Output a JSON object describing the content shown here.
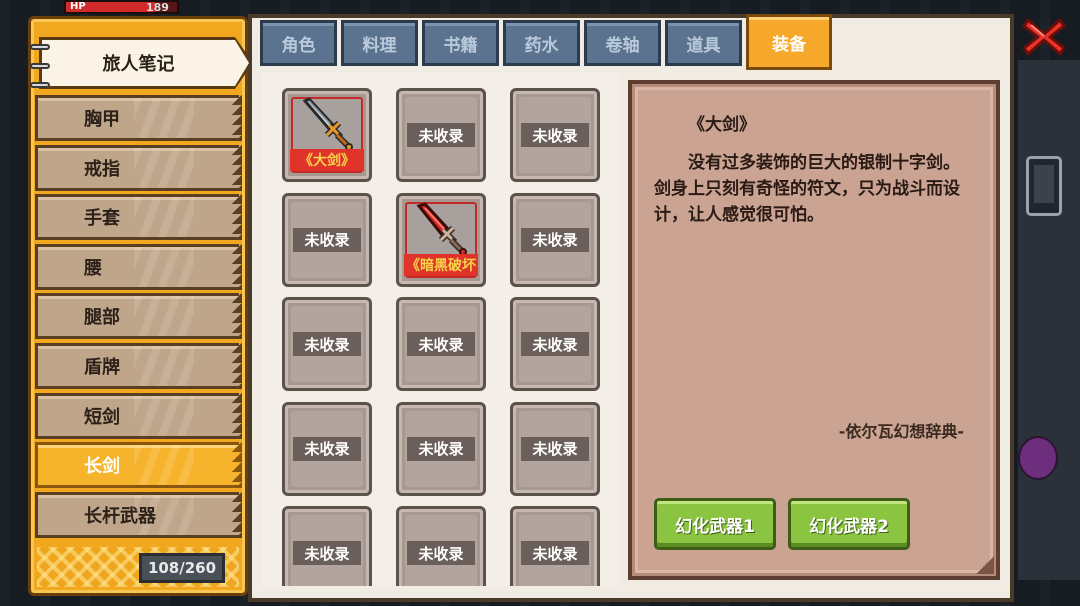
{
  "hud": {
    "hp_label": "HP",
    "hp_value": "189",
    "hp_fraction": 0.8
  },
  "sidebar": {
    "notebook_title": "旅人笔记",
    "categories": [
      {
        "label": "胸甲",
        "active": false
      },
      {
        "label": "戒指",
        "active": false
      },
      {
        "label": "手套",
        "active": false
      },
      {
        "label": "腰",
        "active": false
      },
      {
        "label": "腿部",
        "active": false
      },
      {
        "label": "盾牌",
        "active": false
      },
      {
        "label": "短剑",
        "active": false
      },
      {
        "label": "长剑",
        "active": true
      },
      {
        "label": "长杆武器",
        "active": false
      }
    ],
    "counter": "108/260"
  },
  "tabs": [
    {
      "label": "角色",
      "active": false
    },
    {
      "label": "料理",
      "active": false
    },
    {
      "label": "书籍",
      "active": false
    },
    {
      "label": "药水",
      "active": false
    },
    {
      "label": "卷轴",
      "active": false
    },
    {
      "label": "道具",
      "active": false
    },
    {
      "label": "装备",
      "active": true
    }
  ],
  "grid": {
    "uncollected_label": "未收录",
    "items": [
      {
        "owned": true,
        "name": "《大剑》",
        "icon": "silver-greatsword-icon"
      },
      {
        "owned": false
      },
      {
        "owned": false
      },
      {
        "owned": false
      },
      {
        "owned": true,
        "name": "《暗黑破坏",
        "icon": "dark-red-sword-icon"
      },
      {
        "owned": false
      },
      {
        "owned": false
      },
      {
        "owned": false
      },
      {
        "owned": false
      },
      {
        "owned": false
      },
      {
        "owned": false
      },
      {
        "owned": false
      },
      {
        "owned": false
      },
      {
        "owned": false
      },
      {
        "owned": false
      }
    ]
  },
  "detail": {
    "title": "《大剑》",
    "description": "没有过多装饰的巨大的银制十字剑。剑身上只刻有奇怪的符文，只为战斗而设计，让人感觉很可怕。",
    "source": "-依尔瓦幻想辞典-",
    "button_1": "幻化武器1",
    "button_2": "幻化武器2"
  },
  "colors": {
    "sidebar_orange": "#f2a81e",
    "tab_blue": "#5c7390",
    "active_tab": "#f6a82a",
    "morph_button_green": "#8bc440",
    "close_red": "#e8322a"
  }
}
